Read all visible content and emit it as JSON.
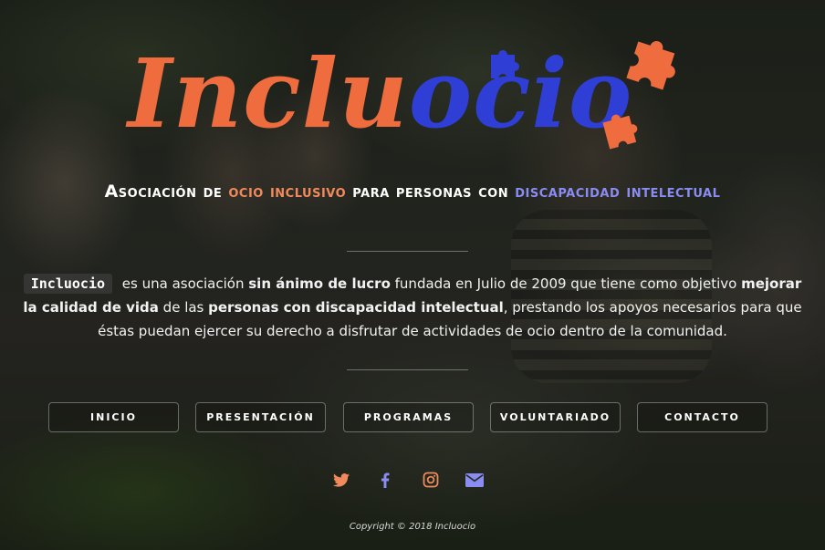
{
  "logo": {
    "part_a": "Inclu",
    "part_b": "ocio",
    "colors": {
      "orange": "#ef6c3e",
      "blue": "#2f3fd6"
    }
  },
  "tagline": {
    "t1": "Asociación de ",
    "t2": "ocio inclusivo",
    "t3": " para personas con ",
    "t4": "discapacidad intelectual"
  },
  "description": {
    "badge": "Incluocio",
    "p1": " es una asociación ",
    "b1": "sin ánimo de lucro",
    "p2": " fundada en Julio de 2009 que tiene como objetivo ",
    "b2": "mejorar la calidad de vida",
    "p3": " de las ",
    "b3": "personas con discapacidad intelectual",
    "p4": ", prestando los apoyos necesarios para que éstas puedan ejercer su derecho a disfrutar de actividades de ocio dentro de la comunidad."
  },
  "nav": [
    {
      "label": "INICIO"
    },
    {
      "label": "PRESENTACIÓN"
    },
    {
      "label": "PROGRAMAS"
    },
    {
      "label": "VOLUNTARIADO"
    },
    {
      "label": "CONTACTO"
    }
  ],
  "social": [
    {
      "icon": "twitter-icon",
      "color": "#f08a5d"
    },
    {
      "icon": "facebook-icon",
      "color": "#8a8cf2"
    },
    {
      "icon": "instagram-icon",
      "color": "#f08a5d"
    },
    {
      "icon": "email-icon",
      "color": "#8a8cf2"
    }
  ],
  "footer": {
    "copyright": "Copyright © 2018 Incluocio"
  }
}
